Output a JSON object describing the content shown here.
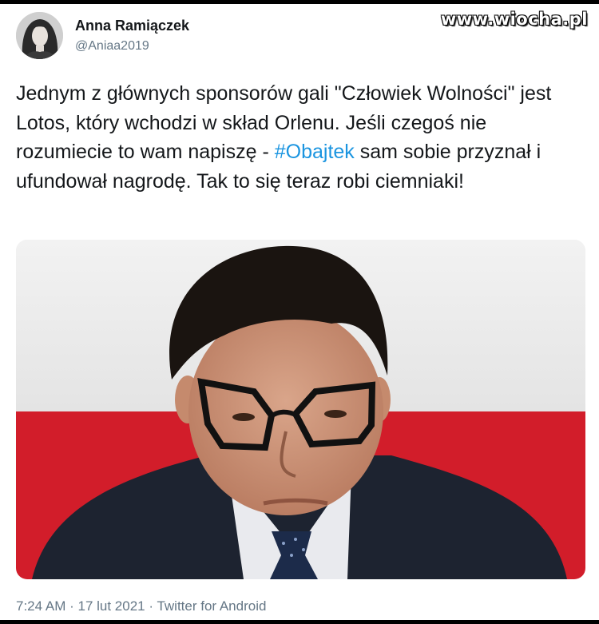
{
  "watermark": "www.wiocha.pl",
  "author": {
    "name": "Anna Ramiączek",
    "handle": "@Aniaa2019"
  },
  "tweet": {
    "text_before": "Jednym z głównych sponsorów gali \"Człowiek Wolności\" jest Lotos, który wchodzi w skład Orlenu. Jeśli czegoś nie rozumiecie to wam napiszę - ",
    "hashtag": "#Obajtek",
    "text_after": " sam sobie przyznał i ufundował nagrodę. Tak to się teraz robi ciemniaki!"
  },
  "meta": {
    "time": "7:24 AM",
    "separator1": " · ",
    "date": "17 lut 2021",
    "separator2": " · ",
    "source": "Twitter for Android"
  },
  "colors": {
    "text": "#14171a",
    "secondary": "#657786",
    "link": "#1b95e0",
    "flag_red": "#d21d2a"
  }
}
